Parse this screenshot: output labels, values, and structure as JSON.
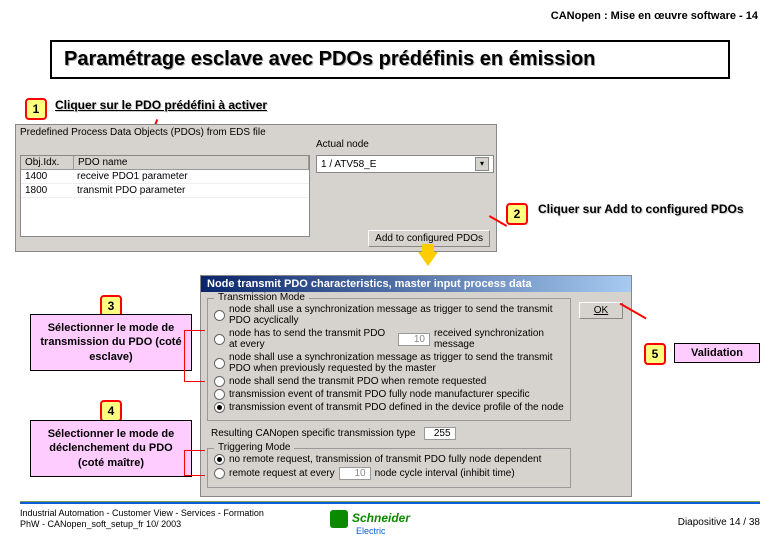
{
  "header": "CANopen : Mise en œuvre software -  14",
  "title": "Paramétrage esclave avec PDOs prédéfinis en émission",
  "steps": {
    "s1": "Cliquer sur le PDO prédéfini à activer",
    "s2": "Cliquer sur Add to configured PDOs",
    "s3": "Sélectionner le mode de transmission du PDO (coté esclave)",
    "s4": "Sélectionner le mode de déclenchement du PDO (coté maître)",
    "s5": "Validation"
  },
  "topApp": {
    "groupLabel": "Predefined Process Data Objects (PDOs) from EDS file",
    "col1": "Obj.Idx.",
    "col2": "PDO name",
    "row1a": "1400",
    "row1b": "receive PDO1 parameter",
    "row2a": "1800",
    "row2b": "transmit PDO parameter",
    "actualLabel": "Actual node",
    "actualValue": "1 / ATV58_E",
    "addBtn": "Add to configured PDOs"
  },
  "botApp": {
    "title": "Node transmit PDO characteristics, master input process data",
    "tmLabel": "Transmission Mode",
    "r1": "node shall use a synchronization message as trigger to send the transmit PDO acyclically",
    "r2a": "node has to send the transmit PDO at every",
    "r2v": "10",
    "r2b": "received synchronization message",
    "r3": "node shall use a synchronization message as trigger to send the transmit PDO when previously requested by the master",
    "r4": "node shall send the transmit PDO when remote requested",
    "r5": "transmission event of transmit PDO fully node manufacturer specific",
    "r6": "transmission event of transmit PDO defined in the device profile of the node",
    "resultLabel": "Resulting CANopen specific transmission type",
    "resultValue": "255",
    "trgLabel": "Triggering Mode",
    "t1": "no remote request, transmission of transmit PDO fully node dependent",
    "t2a": "remote request at every",
    "t2v": "10",
    "t2b": "node cycle interval (inhibit time)",
    "ok": "OK"
  },
  "footer": {
    "l1": "Industrial Automation -  Customer View -  Services - Formation",
    "l2": "PhW - CANopen_soft_setup_fr  10/ 2003",
    "page": "Diapositive 14 / 38",
    "logo": "Schneider",
    "logoSub": "Electric"
  }
}
